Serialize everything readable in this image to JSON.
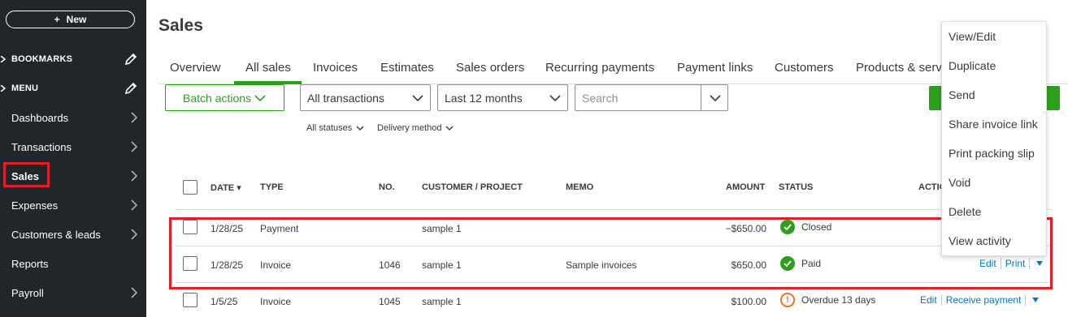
{
  "sidebar": {
    "new_label": "New",
    "new_icon": "plus-icon",
    "bookmarks_label": "BOOKMARKS",
    "menu_label": "MENU",
    "items": [
      {
        "label": "Dashboards",
        "icon": "chevron-right-icon"
      },
      {
        "label": "Transactions",
        "icon": "chevron-right-icon"
      },
      {
        "label": "Sales",
        "icon": "chevron-right-icon"
      },
      {
        "label": "Expenses",
        "icon": "chevron-right-icon"
      },
      {
        "label": "Customers & leads",
        "icon": "chevron-right-icon"
      },
      {
        "label": "Reports",
        "icon": ""
      },
      {
        "label": "Payroll",
        "icon": "chevron-right-icon"
      }
    ],
    "highlight_color": "#e01f27",
    "bg_color": "#21262b"
  },
  "page": {
    "title": "Sales",
    "tabs": [
      "Overview",
      "All sales",
      "Invoices",
      "Estimates",
      "Sales orders",
      "Recurring payments",
      "Payment links",
      "Customers",
      "Products & servi"
    ],
    "active_tab": "All sales",
    "accent_color": "#2ca01c"
  },
  "toolbar": {
    "batch_label": "Batch actions",
    "type_select": "All transactions",
    "date_select": "Last 12 months",
    "search_placeholder": "Search",
    "status_filter": "All statuses",
    "delivery_filter": "Delivery method"
  },
  "table": {
    "headers": {
      "date": "DATE",
      "type": "TYPE",
      "no": "NO.",
      "customer": "CUSTOMER / PROJECT",
      "memo": "MEMO",
      "amount": "AMOUNT",
      "status": "STATUS",
      "action": "ACTIO"
    },
    "rows": [
      {
        "date": "1/28/25",
        "type": "Payment",
        "no": "",
        "customer": "sample 1",
        "memo": "",
        "amount": "−$650.00",
        "status": "Closed",
        "status_kind": "ok",
        "actions": []
      },
      {
        "date": "1/28/25",
        "type": "Invoice",
        "no": "1046",
        "customer": "sample 1",
        "memo": "Sample invoices",
        "amount": "$650.00",
        "status": "Paid",
        "status_kind": "ok",
        "actions": [
          "Edit",
          "Print"
        ]
      },
      {
        "date": "1/5/25",
        "type": "Invoice",
        "no": "1045",
        "customer": "sample 1",
        "memo": "",
        "amount": "$100.00",
        "status": "Overdue 13 days",
        "status_kind": "warn",
        "actions": [
          "Edit",
          "Receive payment"
        ]
      }
    ]
  },
  "context_menu": {
    "items": [
      "View/Edit",
      "Duplicate",
      "Send",
      "Share invoice link",
      "Print packing slip",
      "Void",
      "Delete",
      "View activity"
    ]
  }
}
